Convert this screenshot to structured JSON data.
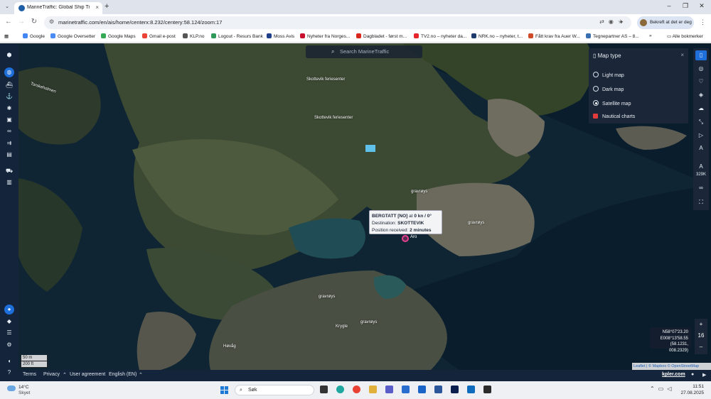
{
  "browser": {
    "tab_title": "MarineTraffic: Global Ship Track",
    "url": "marinetraffic.com/en/ais/home/centerx:8.232/centery:58.124/zoom:17",
    "profile_label": "Bekreft at det er deg",
    "bookmarks": [
      "Google",
      "Google Oversetter",
      "Google Maps",
      "Gmail e-post",
      "KLP.no",
      "Logout - Resurs Bank",
      "Moss Avis",
      "Nyheter fra Norges...",
      "Dagbladet - først m...",
      "TV2.no – nyheter da...",
      "NRK.no – nyheter, t...",
      "Fått krav fra Auer W...",
      "Tegnepartner AS – 8..."
    ],
    "all_bookmarks": "Alle bokmerker"
  },
  "map": {
    "search_placeholder": "Search MarineTraffic",
    "map_type": {
      "title": "Map type",
      "options": [
        "Light map",
        "Dark map",
        "Satellite map"
      ],
      "selected": "Satellite map",
      "nautical": "Nautical charts"
    },
    "vessel_count": "329K",
    "zoom_level": "16",
    "coordinates": {
      "lat": "N58°07'23.20",
      "lon": "E008°13'58.55",
      "decimal": "(58.1231, 008.2329)"
    },
    "popup": {
      "name": "BERGTATT [NO]",
      "speed_prefix": " at ",
      "speed": "0 kn / 0°",
      "destination_label": "Destination: ",
      "destination": "SKOTTEVIK",
      "received_label": "Position received: ",
      "received": "2 minutes ago"
    },
    "vessel_label": "Aro",
    "places": [
      "Torskeholmen",
      "Skottevik feriesenter",
      "Skottevik feriesenter",
      "gravrøys",
      "gravrøys",
      "gravrøys",
      "gravrøys",
      "Krygle",
      "Høvåg"
    ],
    "scale": [
      "50 m",
      "200 ft"
    ],
    "attribution": "Leaflet | © Mapbox © OpenStreetMap"
  },
  "footer": {
    "terms": "Terms",
    "privacy": "Privacy",
    "user_agreement": "User agreement",
    "language": "English (EN)",
    "brand": "kpler.com"
  },
  "taskbar": {
    "temp": "14°C",
    "weather": "Skyet",
    "search": "Søk",
    "time": "11:51",
    "date": "27.08.2025"
  },
  "colors": {
    "map_panel": "#1b2738",
    "accent": "#1e6fd9",
    "vessel": "#e2408f"
  }
}
